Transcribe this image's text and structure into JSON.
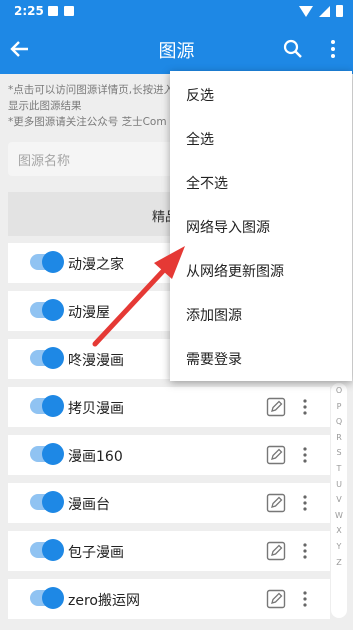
{
  "status_bar": {
    "time": "2:25"
  },
  "app_bar": {
    "title": "图源"
  },
  "hint": {
    "line1": "*点击可以访问图源详情页,长按进入",
    "line2": "显示此图源结果",
    "line3": "*更多图源请关注公众号 芝士Com"
  },
  "search": {
    "placeholder": "图源名称"
  },
  "tab": {
    "label": "精品"
  },
  "sources": [
    "动漫之家",
    "动漫屋",
    "咚漫漫画",
    "拷贝漫画",
    "漫画160",
    "漫画台",
    "包子漫画",
    "zero搬运网"
  ],
  "index_letters": [
    "O",
    "P",
    "Q",
    "R",
    "S",
    "T",
    "U",
    "V",
    "W",
    "X",
    "Y",
    "Z"
  ],
  "menu": {
    "items": [
      "反选",
      "全选",
      "全不选",
      "网络导入图源",
      "从网络更新图源",
      "添加图源",
      "需要登录"
    ]
  },
  "colors": {
    "primary": "#1e88e5",
    "annotation_arrow": "#e53935"
  }
}
